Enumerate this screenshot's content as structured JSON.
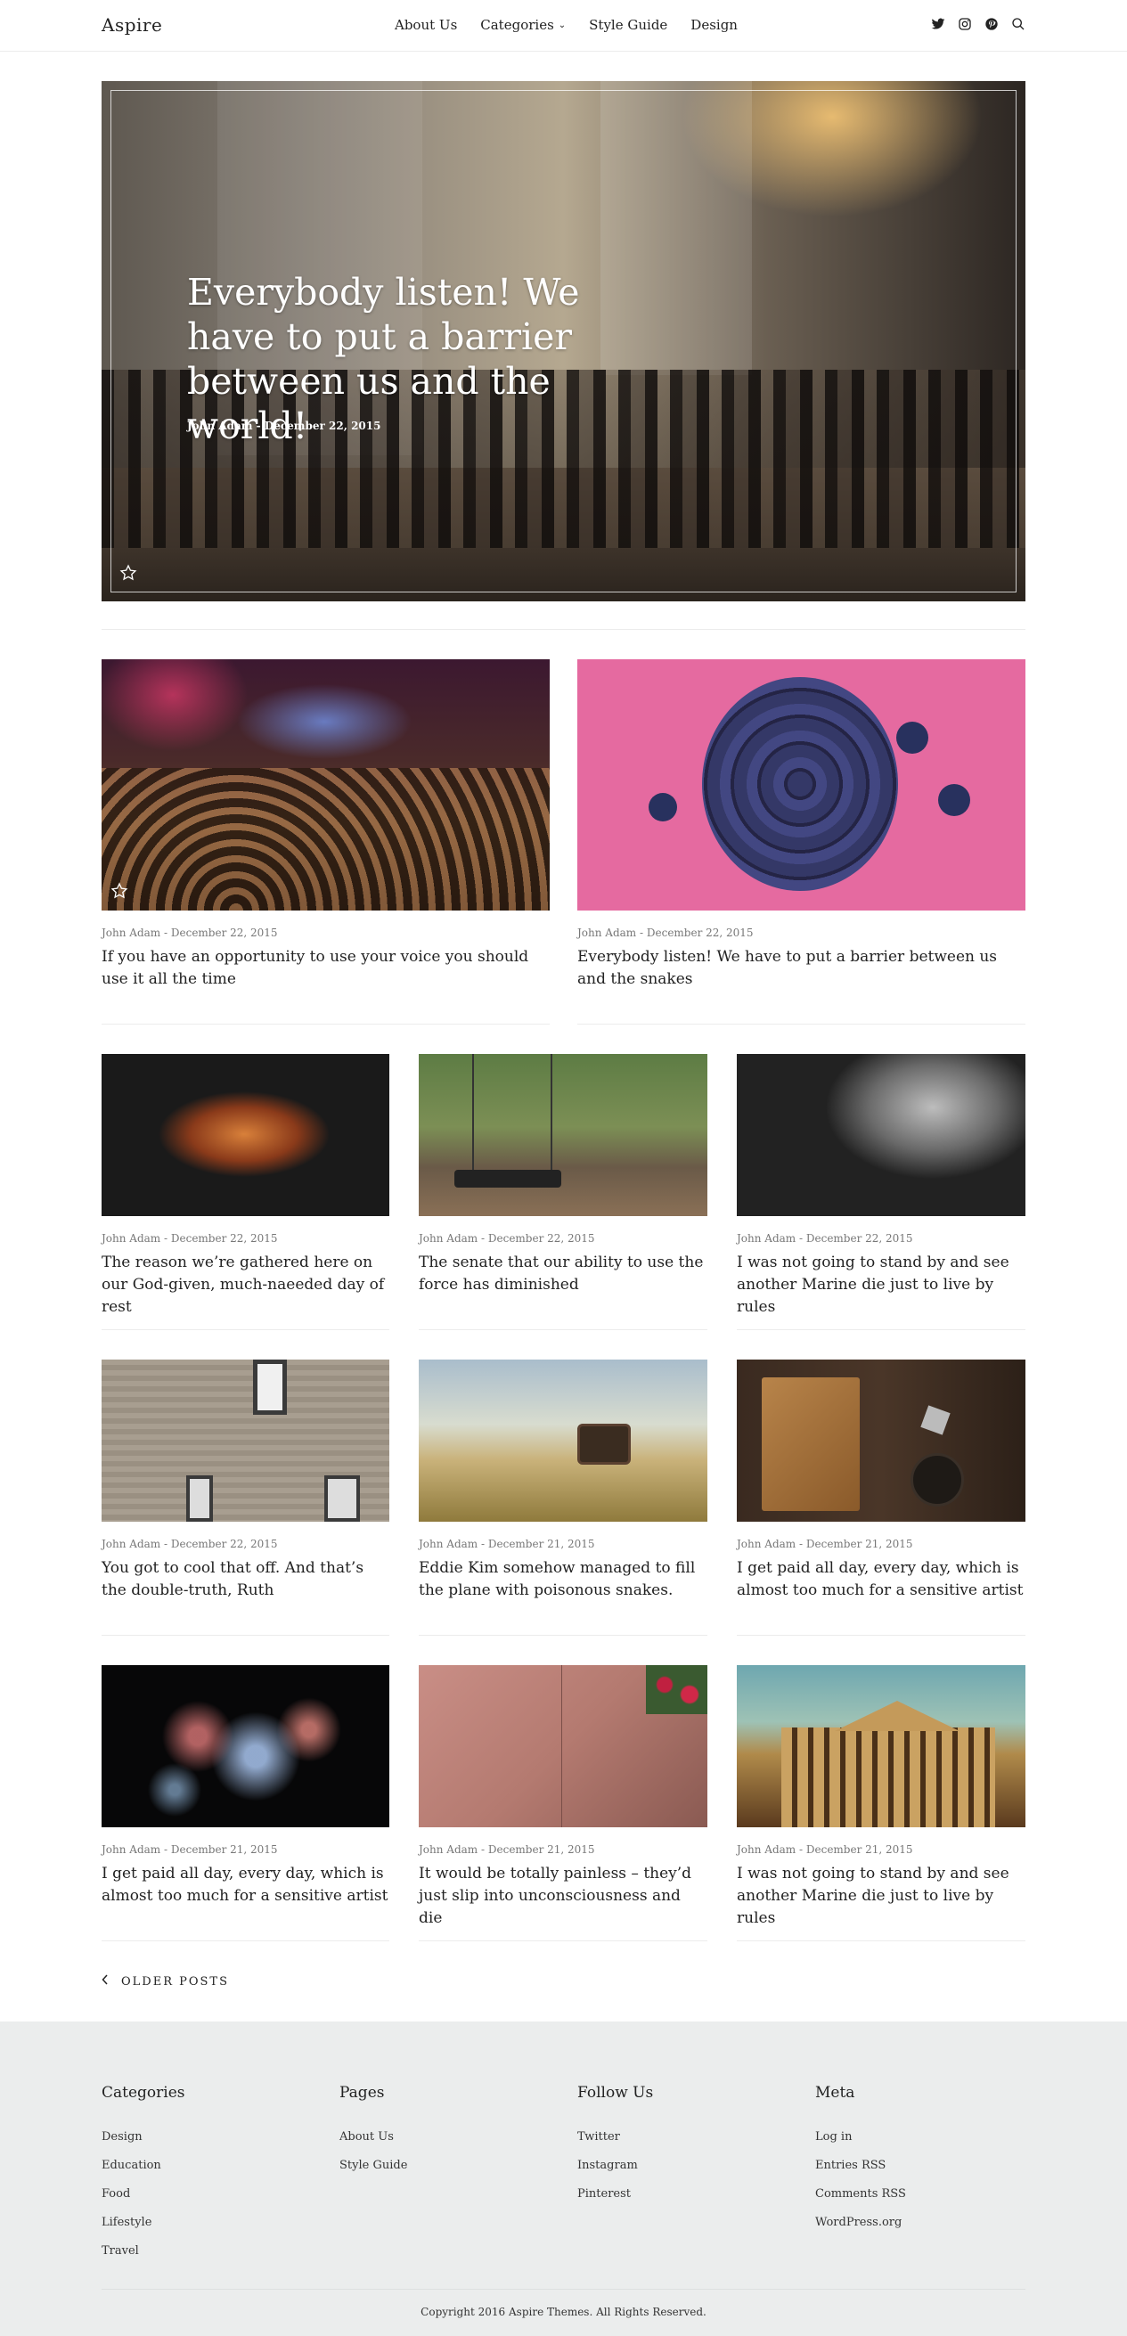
{
  "header": {
    "logo": "Aspire",
    "nav": [
      {
        "label": "About Us"
      },
      {
        "label": "Categories"
      },
      {
        "label": "Style Guide"
      },
      {
        "label": "Design"
      }
    ],
    "social_icons": [
      "twitter-icon",
      "instagram-icon",
      "pinterest-icon",
      "search-icon"
    ]
  },
  "hero": {
    "title": "Everybody listen! We have to put a barrier between us and the world!",
    "meta": "John Adam - December 22, 2015",
    "featured_icon": "star-icon"
  },
  "featured_posts": [
    {
      "meta": "John Adam - December 22, 2015",
      "title": "If you have an opportunity to use your voice you should use it all the time",
      "featured_icon": "star-icon"
    },
    {
      "meta": "John Adam - December 22, 2015",
      "title": "Everybody listen! We have to put a barrier between us and the snakes"
    }
  ],
  "posts": [
    {
      "meta": "John Adam - December 22, 2015",
      "title": "The reason we’re gathered here on our God-given, much-naeeded day of rest"
    },
    {
      "meta": "John Adam - December 22, 2015",
      "title": "The senate that our ability to use the force has diminished"
    },
    {
      "meta": "John Adam - December 22, 2015",
      "title": "I was not going to stand by and see another Marine die just to live by rules"
    },
    {
      "meta": "John Adam - December 22, 2015",
      "title": "You got to cool that off. And that’s the double-truth, Ruth"
    },
    {
      "meta": "John Adam - December 21, 2015",
      "title": "Eddie Kim somehow managed to fill the plane with poisonous snakes."
    },
    {
      "meta": "John Adam - December 21, 2015",
      "title": "I get paid all day, every day, which is almost too much for a sensitive artist"
    },
    {
      "meta": "John Adam - December 21, 2015",
      "title": "I get paid all day, every day, which is almost too much for a sensitive artist"
    },
    {
      "meta": "John Adam - December 21, 2015",
      "title": "It would be totally painless – they’d just slip into unconsciousness and die"
    },
    {
      "meta": "John Adam - December 21, 2015",
      "title": "I was not going to stand by and see another Marine die just to live by rules"
    }
  ],
  "pagination": {
    "older_label": "OLDER POSTS"
  },
  "footer": {
    "columns": [
      {
        "heading": "Categories",
        "items": [
          "Design",
          "Education",
          "Food",
          "Lifestyle",
          "Travel"
        ]
      },
      {
        "heading": "Pages",
        "items": [
          "About Us",
          "Style Guide"
        ]
      },
      {
        "heading": "Follow Us",
        "items": [
          "Twitter",
          "Instagram",
          "Pinterest"
        ]
      },
      {
        "heading": "Meta",
        "items": [
          "Log in",
          "Entries RSS",
          "Comments RSS",
          "WordPress.org"
        ]
      }
    ],
    "copyright": "Copyright 2016 Aspire Themes. All Rights Reserved."
  }
}
